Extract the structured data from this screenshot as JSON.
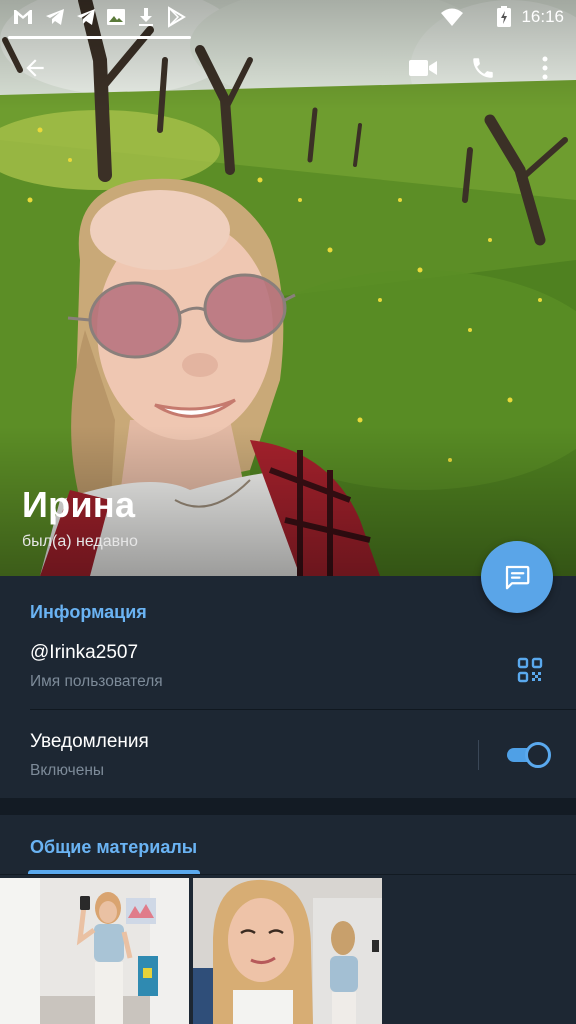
{
  "status_bar": {
    "time": "16:16",
    "icons": [
      "gmail-icon",
      "telegram-icon",
      "telegram-icon",
      "image-icon",
      "download-icon",
      "play-store-icon",
      "wifi-icon",
      "battery-icon"
    ]
  },
  "toolbar": {
    "icons": [
      "back-arrow-icon",
      "video-call-icon",
      "phone-icon",
      "more-vert-icon"
    ]
  },
  "profile": {
    "name": "Ирина",
    "status": "был(а) недавно"
  },
  "info": {
    "section_title": "Информация",
    "username": "@Irinka2507",
    "username_label": "Имя пользователя",
    "notifications_title": "Уведомления",
    "notifications_status": "Включены",
    "notifications_enabled": true
  },
  "media": {
    "tab_label": "Общие материалы",
    "thumbnails": 2
  },
  "colors": {
    "accent": "#6ab3f3",
    "fab": "#5aa5e8",
    "background": "#1d2733",
    "secondary_text": "#7d8b99"
  }
}
